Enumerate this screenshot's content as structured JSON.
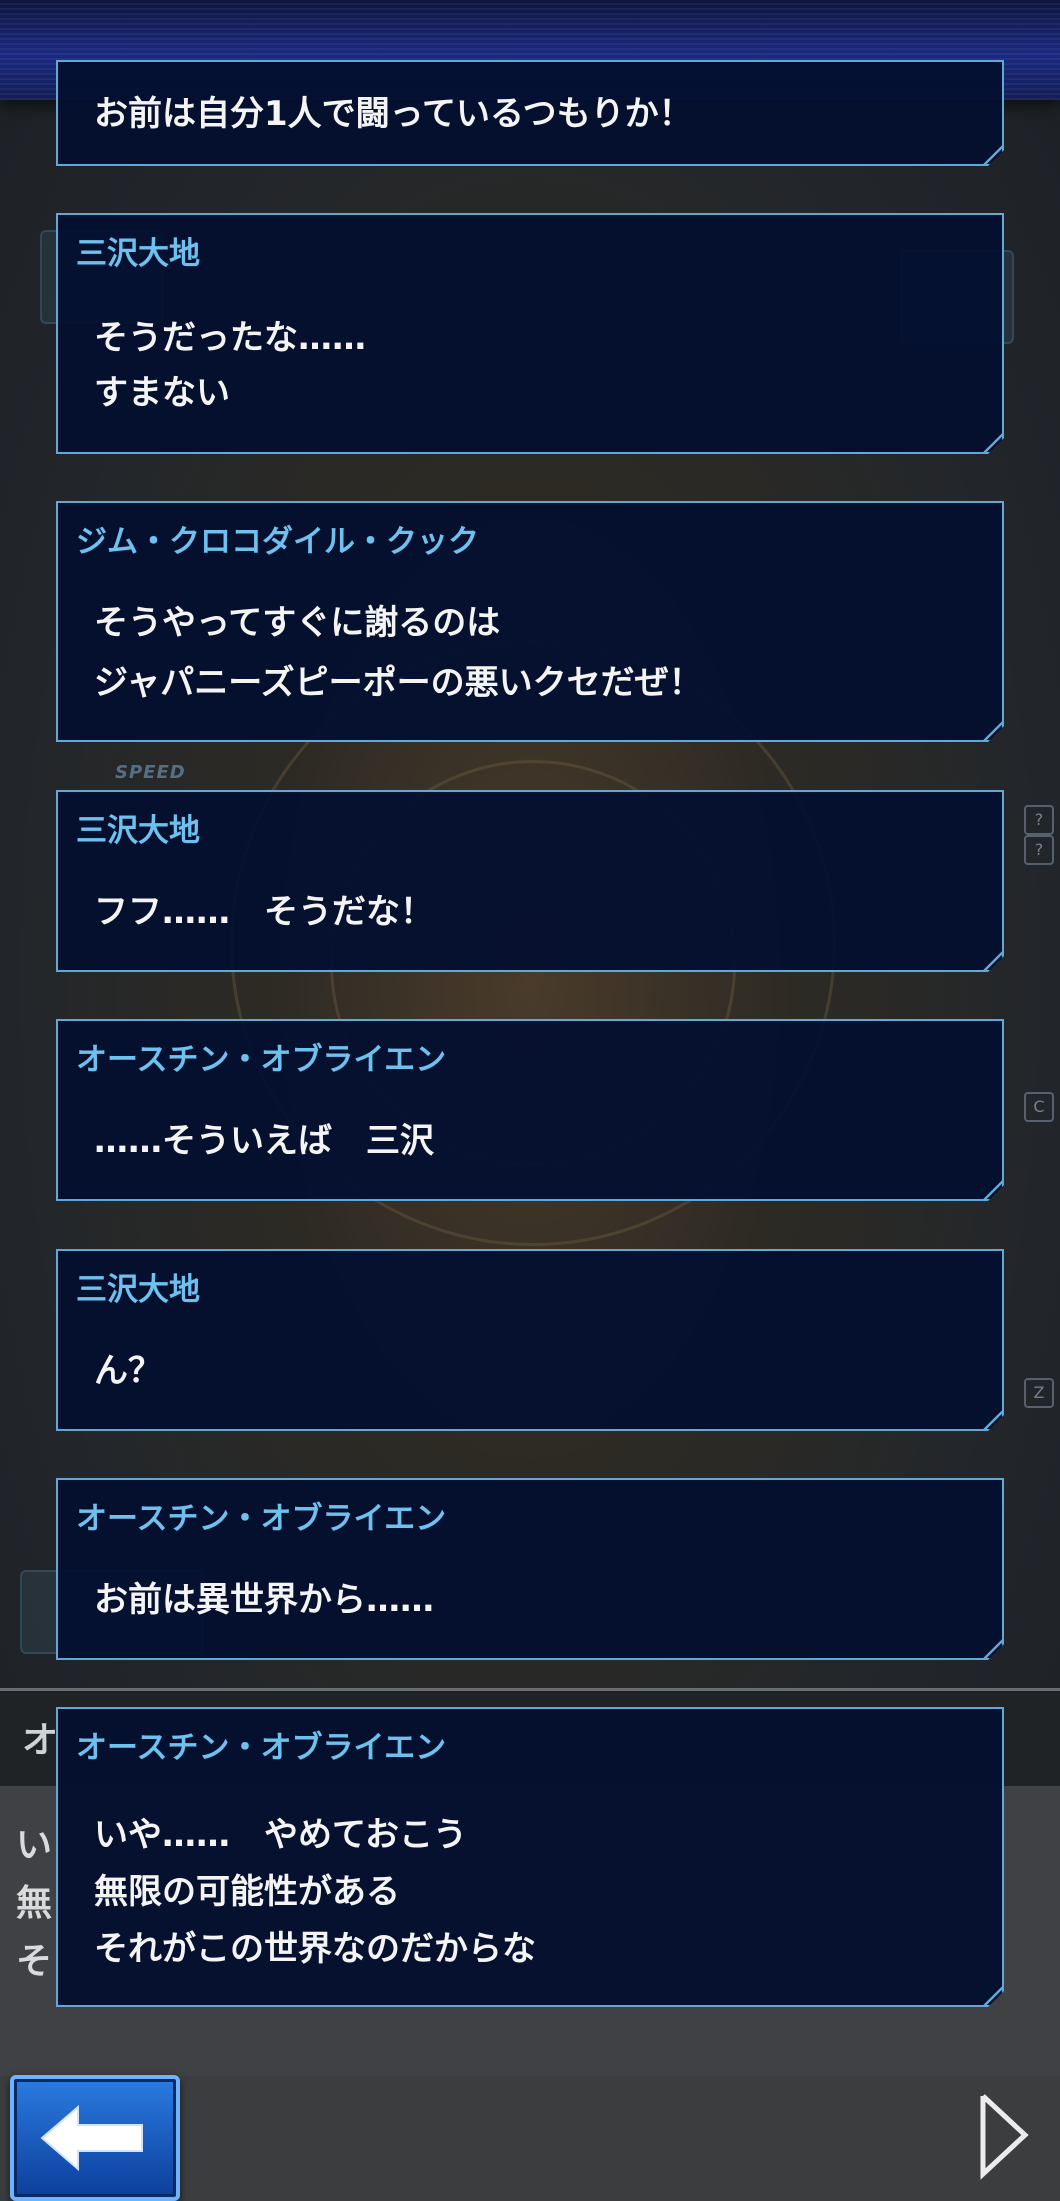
{
  "scene": {
    "speed_label": "SPEED",
    "side_ticks": [
      "?",
      "?",
      "C",
      "Z"
    ]
  },
  "lower_panel": {
    "name_fragment": "オ",
    "text_fragments": [
      "い",
      "無",
      "そ"
    ]
  },
  "dialogues": [
    {
      "speaker": "",
      "lines": [
        "お前は自分1人で闘っているつもりか！"
      ]
    },
    {
      "speaker": "三沢大地",
      "lines": [
        "そうだったな……",
        "すまない"
      ]
    },
    {
      "speaker": "ジム・クロコダイル・クック",
      "lines": [
        "そうやってすぐに謝るのは",
        "ジャパニーズピーポーの悪いクセだぜ！"
      ]
    },
    {
      "speaker": "三沢大地",
      "lines": [
        "フフ……　そうだな！"
      ]
    },
    {
      "speaker": "オースチン・オブライエン",
      "lines": [
        "……そういえば　三沢"
      ]
    },
    {
      "speaker": "三沢大地",
      "lines": [
        "ん？"
      ]
    },
    {
      "speaker": "オースチン・オブライエン",
      "lines": [
        "お前は異世界から……"
      ]
    },
    {
      "speaker": "オースチン・オブライエン",
      "lines": [
        "いや……　やめておこう",
        "無限の可能性がある",
        "それがこの世界なのだからな"
      ]
    }
  ],
  "controls": {
    "back_icon": "left-arrow-icon",
    "next_icon": "play-triangle-icon",
    "accent": "#2b7be0",
    "border": "#5ea9d8",
    "speaker_color": "#6ec0ee"
  }
}
